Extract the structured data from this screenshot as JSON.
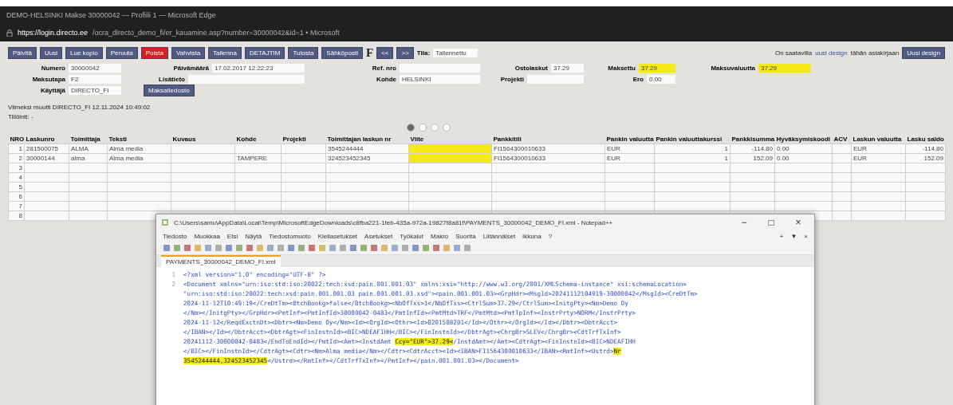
{
  "browser": {
    "title": "DEMO-HELSINKI Makse 30000042 — Profiili 1 — Microsoft Edge",
    "url_host": "https://login.directo.ee",
    "url_path": "/ocra_directo_demo_fi/er_kauamine.asp?number=30000042&id=1 • Microsoft"
  },
  "toolbar": {
    "buttons": [
      {
        "label": "Päivitä",
        "danger": false
      },
      {
        "label": "Uusi",
        "danger": false
      },
      {
        "label": "Lue kopio",
        "danger": false
      },
      {
        "label": "Peruuta",
        "danger": false
      },
      {
        "label": "Poista",
        "danger": true
      },
      {
        "label": "Vahvista",
        "danger": false
      },
      {
        "label": "Tallenna",
        "danger": false
      },
      {
        "label": "DETAJTIM",
        "danger": false
      },
      {
        "label": "Tulosta",
        "danger": false
      },
      {
        "label": "Sähköposti",
        "danger": false
      }
    ],
    "logo": "F",
    "small_buttons": [
      "<<",
      ">>"
    ],
    "status_label": "Tila:",
    "status_value": "Tallennettu"
  },
  "design_notice": {
    "before": "On saatavilla",
    "link": "uusi design",
    "after": "tähän asiakirjaan",
    "button": "Uusi design"
  },
  "form": [
    [
      {
        "label": "Numero",
        "value": "30000042",
        "highlighted": false
      },
      {
        "label": "Päivämäärä",
        "value": "17.02.2017 12:22:23",
        "highlighted": false
      },
      {
        "label": "Ref. nro",
        "highlighted": false
      },
      {
        "label": "Ostolaskut",
        "value": "37.29",
        "highlighted": false
      },
      {
        "label": "Maksettu",
        "value": "37.29",
        "highlighted": true
      },
      {
        "label": "Maksuvaluutta",
        "value": "37.29",
        "highlighted": true
      }
    ],
    [
      {
        "label": "Maksutapa",
        "value": "F2",
        "highlighted": false
      },
      {
        "label": "Lisätieto",
        "highlighted": false
      },
      {
        "label": "Kohde",
        "value": "HELSINKI",
        "highlighted": false
      },
      {
        "label": "Projekti",
        "highlighted": false
      },
      {
        "label": "Ero",
        "value": "0.00",
        "highlighted": false
      }
    ],
    [
      {
        "label": "Käyttäjä",
        "value": "DIRECTO_FI",
        "highlighted": false
      }
    ]
  ],
  "file_button": "Maksatiedosto",
  "last_modified": "Viimeksi muutti DIRECTO_FI 12.11.2024 10:49:02",
  "posting": "Tiliöinti: -",
  "pager": [
    {
      "selected": true
    },
    {
      "selected": false
    },
    {
      "selected": false
    },
    {
      "selected": false
    }
  ],
  "table": {
    "columns": [
      {
        "label": "NRO",
        "highlighted": false
      },
      {
        "label": "Laskunro",
        "highlighted": false
      },
      {
        "label": "Toimittaja",
        "highlighted": false
      },
      {
        "label": "Teksti",
        "highlighted": false
      },
      {
        "label": "Kuvaus",
        "highlighted": false
      },
      {
        "label": "Kohde",
        "highlighted": false
      },
      {
        "label": "Projekti",
        "highlighted": false
      },
      {
        "label": "Toimittajan laskun nr",
        "highlighted": false
      },
      {
        "label": "Viite",
        "highlighted": true
      },
      {
        "label": "Pankkitili",
        "highlighted": false
      },
      {
        "label": "Pankin valuutta",
        "highlighted": false
      },
      {
        "label": "Pankin valuuttakurssi",
        "highlighted": false
      },
      {
        "label": "Pankkisumma",
        "highlighted": false
      },
      {
        "label": "Hyväksymiskoodi",
        "highlighted": false
      },
      {
        "label": "ACV",
        "highlighted": false
      },
      {
        "label": "Laskun valuutta",
        "highlighted": false
      },
      {
        "label": "Lasku saldo",
        "highlighted": false
      }
    ],
    "rows": [
      {
        "highlighted": true,
        "cells": [
          "1",
          "281500075",
          "ALMA",
          "Alma media",
          null,
          null,
          null,
          "3545244444",
          null,
          "FI1564300010633",
          "EUR",
          "1",
          "-114.80",
          "0.00",
          null,
          "EUR",
          "-114.80"
        ]
      },
      {
        "highlighted": true,
        "cells": [
          "2",
          "30000144",
          "alma",
          "Alma media",
          null,
          "TAMPERE",
          null,
          "324523452345",
          null,
          "FI1564300010633",
          "EUR",
          "1",
          "152.09",
          "0.00",
          null,
          "EUR",
          "152.09"
        ]
      },
      {
        "highlighted": false,
        "cells": [
          "3"
        ]
      },
      {
        "highlighted": false,
        "cells": [
          "4"
        ]
      },
      {
        "highlighted": false,
        "cells": [
          "5"
        ]
      },
      {
        "highlighted": false,
        "cells": [
          "6"
        ]
      },
      {
        "highlighted": false,
        "cells": [
          "7"
        ]
      },
      {
        "highlighted": false,
        "cells": [
          "8"
        ]
      }
    ]
  },
  "notepad": {
    "title": "C:\\Users\\samu\\AppData\\Local\\Temp\\MicrosoftEdgeDownloads\\c8fba221-1feb-435a-972a-19827f8a81f\\PAYMENTS_30000042_DEMO_FI.xml - Notepad++",
    "menu": [
      "Tiedosto",
      "Muokkaa",
      "Etsi",
      "Näytä",
      "Tiedostomuoto",
      "Kieliasetukset",
      "Asetukset",
      "Työkalut",
      "Makro",
      "Suorita",
      "Liitännäiset",
      "Ikkuna",
      "?"
    ],
    "menu_right": [
      "+",
      "▼",
      "×"
    ],
    "window_controls": [
      "−",
      "□",
      "×"
    ],
    "tab": "PAYMENTS_30000042_DEMO_FI.xml",
    "lines": [
      {
        "number": "1",
        "segments": [
          {
            "text": "<?xml version=\"1.0\" encoding=\"UTF-8\" ?>",
            "highlighted": false
          }
        ]
      },
      {
        "number": "2",
        "segments": [
          {
            "text": "<Document xmlns=\"urn:iso:std:iso:20022:tech:xsd:pain.001.001.03\" xmlns:xsi=\"http://www.w3.org/2001/XMLSchema-instance\" xsi:schemaLocation=",
            "highlighted": false
          }
        ]
      },
      {
        "segments": [
          {
            "text": "\"urn:iso:std:iso:20022:tech:xsd:pain.001.001.03 pain.001.001.03.xsd\"><pain.001.001.03><GrpHdr><MsgId>20241112104919-30000042</MsgId><CreDtTm>",
            "highlighted": false
          }
        ]
      },
      {
        "segments": [
          {
            "text": "2024-11-12T10:49:19</CreDtTm><BtchBookg>false</BtchBookg><NbOfTxs>1</NbOfTxs><CtrlSum>37.29</CtrlSum><InitgPty><Nm>Demo Oy",
            "highlighted": false
          }
        ]
      },
      {
        "segments": [
          {
            "text": "</Nm></InitgPty></GrpHdr><PmtInf><PmtInfId>30000042-0483</PmtInfId><PmtMtd>TRF</PmtMtd><PmtTpInf><InstrPrty>NORM</InstrPrty>",
            "highlighted": false
          }
        ]
      },
      {
        "segments": [
          {
            "text": "2024-11-12</ReqdExctnDt><Dbtr><Nm>Demo Oy</Nm><Id><OrgId><Othr><Id>0201508201</Id></Othr></OrgId></Id></Dbtr><DbtrAcct>",
            "highlighted": false
          }
        ]
      },
      {
        "segments": [
          {
            "text": "</IBAN></Id></DbtrAcct><DbtrAgt><FinInstnId><BIC>NDEAFIHH</BIC></FinInstnId></DbtrAgt><ChrgBr>SLEV</ChrgBr><CdtTrfTxInf>",
            "highlighted": false
          }
        ]
      },
      {
        "segments": [
          {
            "text": "20241112-30000042-0483</EndToEndId></PmtId><Amt><InstdAmt ",
            "highlighted": false
          },
          {
            "text": "Ccy=\"EUR\">37.29<",
            "highlighted": true
          },
          {
            "text": "/InstdAmt></Amt><CdtrAgt><FinInstnId><BIC>NDEAFIHH",
            "highlighted": false
          }
        ]
      },
      {
        "segments": [
          {
            "text": "</BIC></FinInstnId></CdtrAgt><Cdtr><Nm>Alma media</Nm></Cdtr><CdtrAcct><Id><IBAN>FI1564300010633</IBAN><RmtInf><Ustrd>",
            "highlighted": false
          },
          {
            "text": "Nr",
            "highlighted": true
          }
        ]
      },
      {
        "segments": [
          {
            "text": "3545244444,324523452345",
            "highlighted": true
          },
          {
            "text": "</Ustrd></RmtInf></CdtTrfTxInf></PmtInf></pain.001.001.03></Document>",
            "highlighted": false
          }
        ]
      }
    ]
  }
}
